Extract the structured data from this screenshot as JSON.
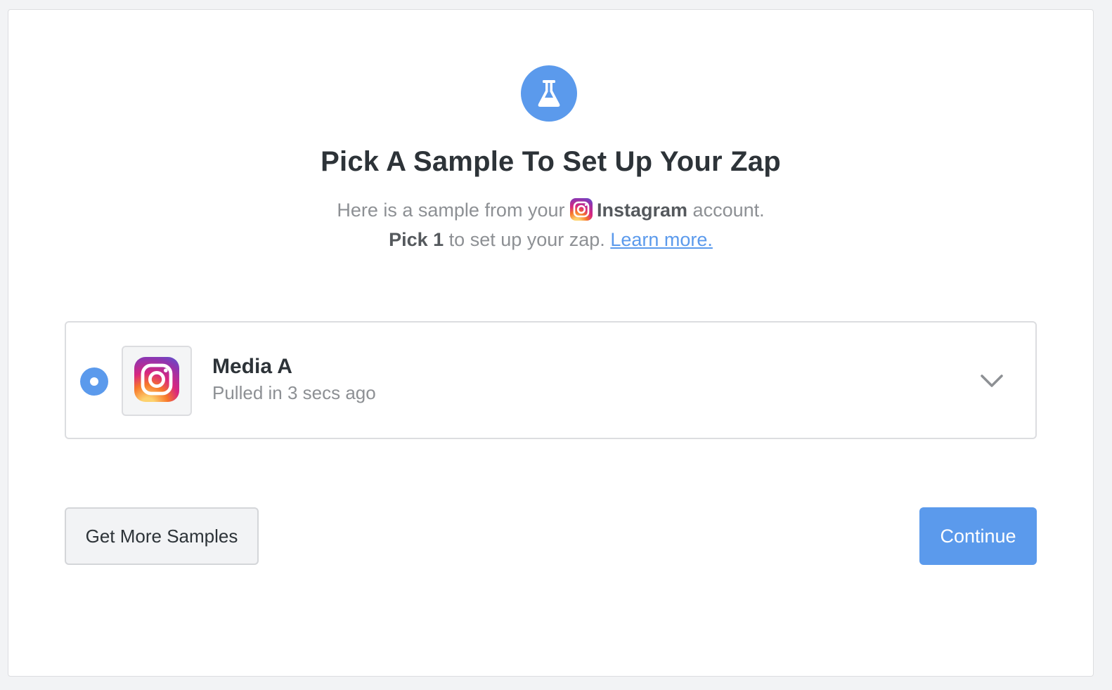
{
  "header": {
    "title": "Pick A Sample To Set Up Your Zap",
    "line1_before": "Here is a sample from your",
    "app_name": "Instagram",
    "line1_after": "account.",
    "line2_bold": "Pick 1",
    "line2_text": "to set up your zap.",
    "learn_more": "Learn more."
  },
  "sample": {
    "selected": true,
    "name": "Media A",
    "meta": "Pulled in 3 secs ago",
    "app_icon": "instagram-icon"
  },
  "actions": {
    "more_label": "Get More Samples",
    "continue_label": "Continue"
  },
  "colors": {
    "accent": "#5b9aec",
    "title": "#2d3338",
    "muted": "#8d9094",
    "border": "#dcdde0"
  }
}
